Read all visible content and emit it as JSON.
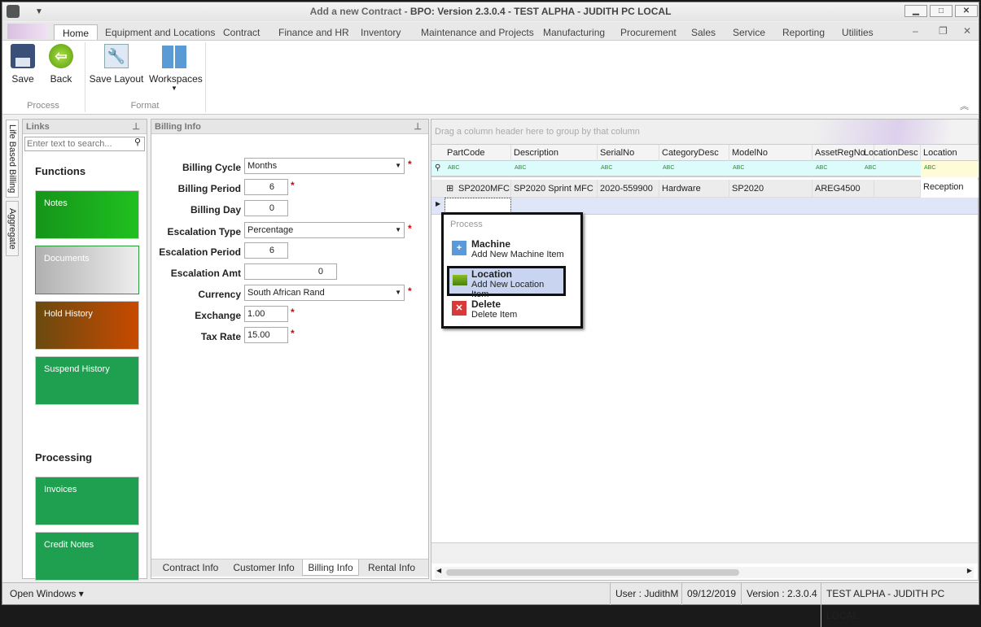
{
  "window": {
    "title_prefix": "Add a new Contract - ",
    "title_main": "BPO: Version 2.3.0.4 - TEST ALPHA - JUDITH PC LOCAL",
    "min": "▁",
    "max": "□",
    "close": "✕"
  },
  "tabs": [
    "Home",
    "Equipment and Locations",
    "Contract",
    "Finance and HR",
    "Inventory",
    "Maintenance and Projects",
    "Manufacturing",
    "Procurement",
    "Sales",
    "Service",
    "Reporting",
    "Utilities"
  ],
  "ribbon": {
    "save": "Save",
    "back": "Back",
    "save_layout": "Save Layout",
    "workspaces": "Workspaces",
    "group_process": "Process",
    "group_format": "Format"
  },
  "side_tabs": [
    "Life Based Billing",
    "Aggregate"
  ],
  "links": {
    "title": "Links",
    "search_placeholder": "Enter text to search...",
    "functions_heading": "Functions",
    "functions": [
      "Notes",
      "Documents",
      "Hold History",
      "Suspend History"
    ],
    "processing_heading": "Processing",
    "processing": [
      "Invoices",
      "Credit Notes"
    ]
  },
  "billing": {
    "title": "Billing Info",
    "fields": {
      "billing_cycle": {
        "label": "Billing Cycle",
        "value": "Months"
      },
      "billing_period": {
        "label": "Billing Period",
        "value": "6"
      },
      "billing_day": {
        "label": "Billing Day",
        "value": "0"
      },
      "escalation_type": {
        "label": "Escalation Type",
        "value": "Percentage"
      },
      "escalation_period": {
        "label": "Escalation Period",
        "value": "6"
      },
      "escalation_amt": {
        "label": "Escalation Amt",
        "value": "0"
      },
      "currency": {
        "label": "Currency",
        "value": "South African Rand"
      },
      "exchange": {
        "label": "Exchange",
        "value": "1.00"
      },
      "tax_rate": {
        "label": "Tax Rate",
        "value": "15.00"
      }
    },
    "required_mark": "*",
    "bottom_tabs": [
      "Contract Info",
      "Customer Info",
      "Billing Info",
      "Rental Info"
    ]
  },
  "grid": {
    "group_hint": "Drag a column header here to group by that column",
    "columns": [
      "PartCode",
      "Description",
      "SerialNo",
      "CategoryDesc",
      "ModelNo",
      "AssetRegNo",
      "LocationDesc",
      "Location"
    ],
    "filter_glyph": "ABC",
    "rows": [
      [
        "SP2020MFC",
        "SP2020 Sprint MFC",
        "2020-559900",
        "Hardware",
        "SP2020",
        "AREG4500",
        "",
        "Reception"
      ]
    ]
  },
  "context_menu": {
    "heading": "Process",
    "items": [
      {
        "title": "Machine",
        "subtitle": "Add New Machine Item"
      },
      {
        "title": "Location",
        "subtitle": "Add New Location Item"
      },
      {
        "title": "Delete",
        "subtitle": "Delete Item"
      }
    ]
  },
  "status": {
    "open_windows": "Open Windows ▾",
    "user": "User : JudithM",
    "date": "09/12/2019",
    "version": "Version : 2.3.0.4",
    "env": "TEST ALPHA - JUDITH PC LOCAL"
  },
  "colors": {
    "notes": "#1aa31a",
    "documents": "#c8c8c8",
    "hold": "#b44a10",
    "green_tile": "#1fa050",
    "accent_selected": "#c8d4f0"
  }
}
